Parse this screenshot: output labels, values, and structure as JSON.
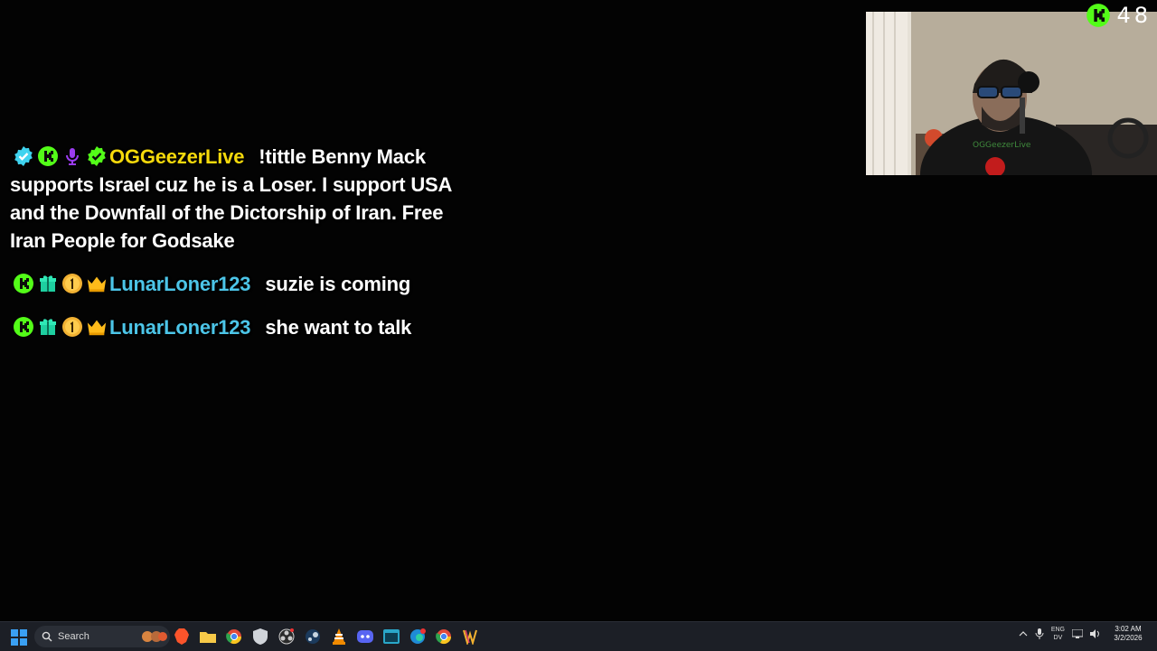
{
  "chat": {
    "messages": [
      {
        "username": "OGGeezerLive",
        "text": "!tittle Benny Mack supports Israel cuz he is a Loser. I support USA and the Downfall of the Dictorship of Iran. Free Iran People for Godsake",
        "badges": [
          "verified-icon",
          "kick-icon",
          "microphone-icon",
          "check-icon"
        ]
      },
      {
        "username": "LunarLoner123",
        "text": "suzie is coming",
        "badges": [
          "kick-icon",
          "gift-icon",
          "one-badge-icon",
          "crown-icon"
        ]
      },
      {
        "username": "LunarLoner123",
        "text": "she want to talk",
        "badges": [
          "kick-icon",
          "gift-icon",
          "one-badge-icon",
          "crown-icon"
        ]
      }
    ]
  },
  "viewer_count": "48",
  "taskbar": {
    "search_label": "Search",
    "lang_top": "ENG",
    "lang_bottom": "DV",
    "time": "3:02 AM",
    "date": "3/2/2026"
  },
  "colors": {
    "kick_green": "#53fc18",
    "user1": "#f5d90b",
    "user2": "#4cc5e8"
  }
}
